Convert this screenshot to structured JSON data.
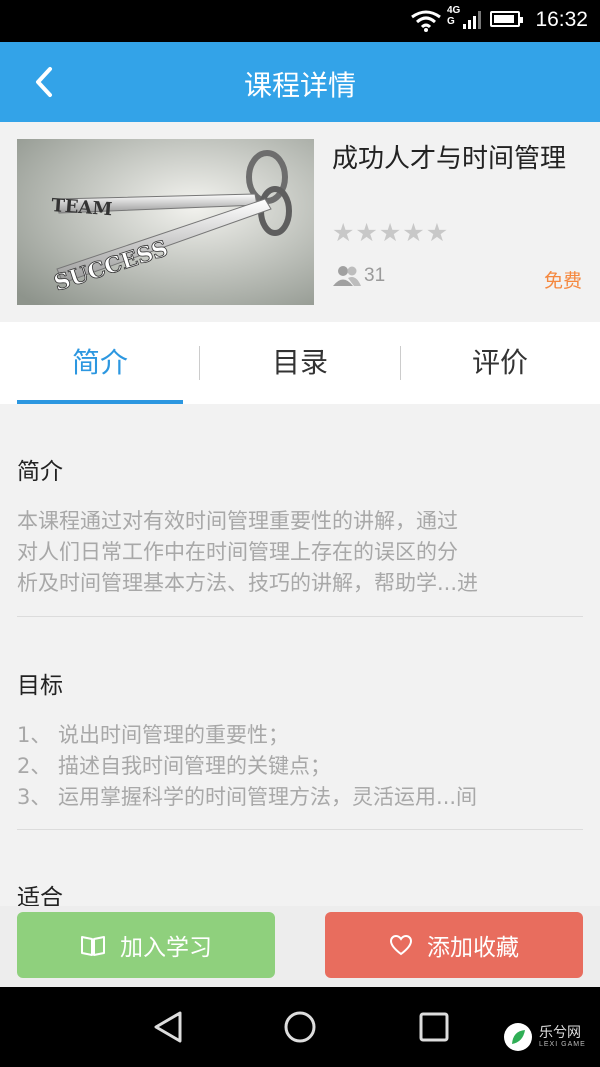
{
  "status_bar": {
    "time": "16:32",
    "network": "4G",
    "network_sub": "G"
  },
  "header": {
    "title": "课程详情",
    "back_icon": "chevron-left-icon"
  },
  "course": {
    "image_words": [
      "TEAM",
      "SUCCESS"
    ],
    "title": "成功人才与时间管理",
    "rating": 0,
    "learners": "31",
    "price": "免费"
  },
  "tabs": [
    {
      "label": "简介",
      "active": true
    },
    {
      "label": "目录",
      "active": false
    },
    {
      "label": "评价",
      "active": false
    }
  ],
  "sections": {
    "intro": {
      "heading": "简介",
      "text_lines": [
        "本课程通过对有效时间管理重要性的讲解，通过",
        "对人们日常工作中在时间管理上存在的误区的分",
        "析及时间管理基本方法、技巧的讲解，帮助学...进"
      ]
    },
    "goals": {
      "heading": "目标",
      "items": [
        "1、 说出时间管理的重要性；",
        "2、 描述自我时间管理的关键点；",
        "3、 运用掌握科学的时间管理方法，灵活运用...间"
      ]
    },
    "audience": {
      "heading": "适合"
    }
  },
  "actions": {
    "join_label": "加入学习",
    "favorite_label": "添加收藏"
  },
  "watermark": {
    "text": "乐兮网",
    "sub": "LEXI GAME"
  },
  "colors": {
    "primary": "#33a3e8",
    "tab_active": "#2c97e0",
    "price": "#f5883f",
    "join": "#8fd07d",
    "favorite": "#e86d5e"
  }
}
